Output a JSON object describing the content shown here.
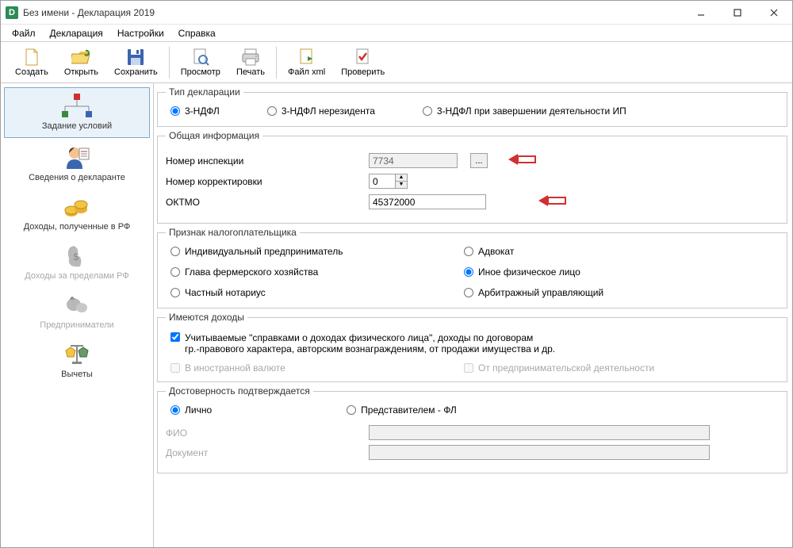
{
  "title": "Без имени - Декларация 2019",
  "appicon_letter": "D",
  "menu": {
    "file": "Файл",
    "decl": "Декларация",
    "settings": "Настройки",
    "help": "Справка"
  },
  "toolbar": {
    "create": "Создать",
    "open": "Открыть",
    "save": "Сохранить",
    "preview": "Просмотр",
    "print": "Печать",
    "filexml": "Файл xml",
    "check": "Проверить"
  },
  "sidebar": {
    "conditions": "Задание условий",
    "declarant": "Сведения о декларанте",
    "income_rf": "Доходы, полученные в РФ",
    "income_abroad": "Доходы за пределами РФ",
    "entrepreneurs": "Предприниматели",
    "deductions": "Вычеты"
  },
  "decl_type": {
    "legend": "Тип декларации",
    "opt1": "3-НДФЛ",
    "opt2": "3-НДФЛ нерезидента",
    "opt3": "3-НДФЛ при завершении деятельности ИП"
  },
  "general": {
    "legend": "Общая информация",
    "inspection_label": "Номер инспекции",
    "inspection_value": "7734",
    "browse": "...",
    "correction_label": "Номер корректировки",
    "correction_value": "0",
    "oktmo_label": "ОКТМО",
    "oktmo_value": "45372000"
  },
  "taxpayer": {
    "legend": "Признак налогоплательщика",
    "ip": "Индивидуальный предприниматель",
    "lawyer": "Адвокат",
    "farmer": "Глава фермерского хозяйства",
    "person": "Иное физическое лицо",
    "notary": "Частный нотариус",
    "arbitr": "Арбитражный управляющий"
  },
  "income": {
    "legend": "Имеются доходы",
    "main_line1": "Учитываемые \"справками о доходах физического лица\", доходы по договорам",
    "main_line2": "гр.-правового характера, авторским вознаграждениям, от продажи имущества и др.",
    "foreign": "В иностранной валюте",
    "business": "От предпринимательской деятельности"
  },
  "trust": {
    "legend": "Достоверность подтверждается",
    "self": "Лично",
    "repr": "Представителем - ФЛ",
    "fio_label": "ФИО",
    "doc_label": "Документ"
  }
}
